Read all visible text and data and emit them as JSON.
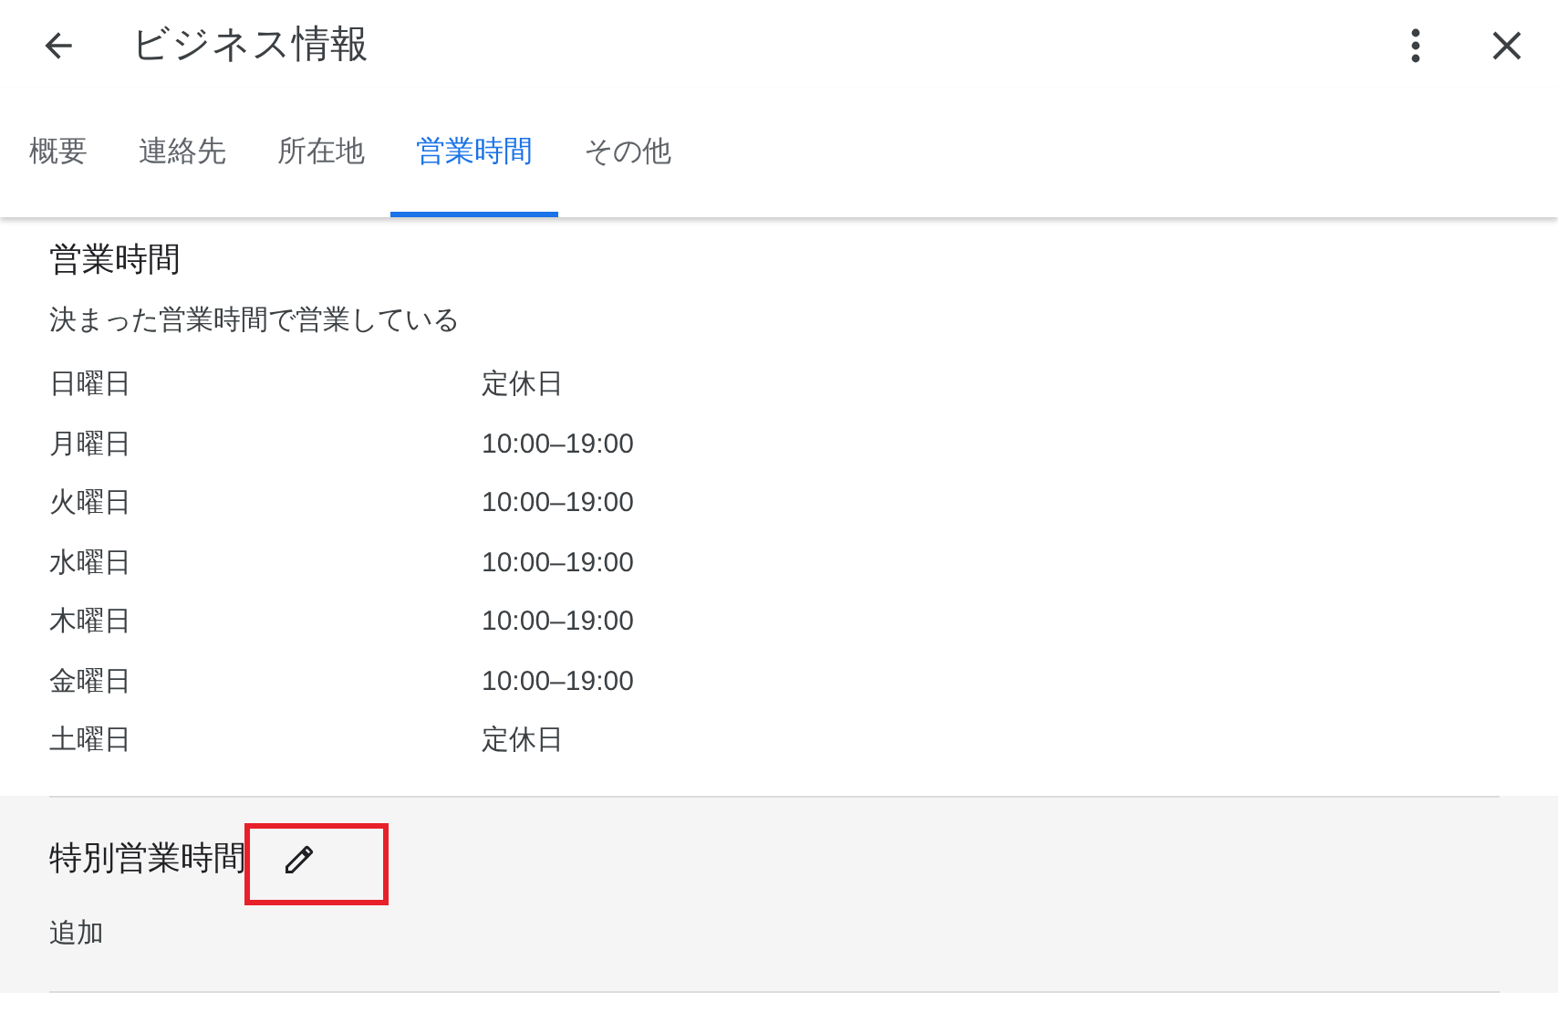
{
  "header": {
    "title": "ビジネス情報"
  },
  "tabs": [
    {
      "label": "概要",
      "selected": false
    },
    {
      "label": "連絡先",
      "selected": false
    },
    {
      "label": "所在地",
      "selected": false
    },
    {
      "label": "営業時間",
      "selected": true
    },
    {
      "label": "その他",
      "selected": false
    }
  ],
  "hours": {
    "title": "営業時間",
    "status": "決まった営業時間で営業している",
    "rows": [
      {
        "day": "日曜日",
        "time": "定休日"
      },
      {
        "day": "月曜日",
        "time": "10:00–19:00"
      },
      {
        "day": "火曜日",
        "time": "10:00–19:00"
      },
      {
        "day": "水曜日",
        "time": "10:00–19:00"
      },
      {
        "day": "木曜日",
        "time": "10:00–19:00"
      },
      {
        "day": "金曜日",
        "time": "10:00–19:00"
      },
      {
        "day": "土曜日",
        "time": "定休日"
      }
    ]
  },
  "special_hours": {
    "title": "特別営業時間",
    "action": "追加",
    "highlighted": true
  }
}
